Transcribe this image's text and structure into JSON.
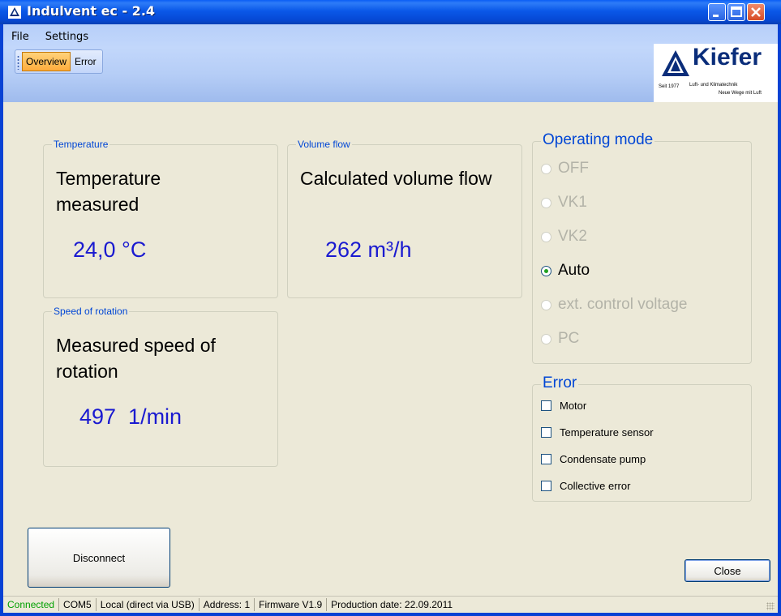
{
  "window": {
    "title": "Indulvent ec - 2.4"
  },
  "menu": {
    "items": [
      "File",
      "Settings"
    ]
  },
  "tabs": [
    {
      "label": "Overview",
      "active": true
    },
    {
      "label": "Error",
      "active": false
    }
  ],
  "logo": {
    "name": "Kiefer",
    "since": "Seit 1977",
    "tagline1": "Luft- und Klimatechnik",
    "tagline2": "Neue Wege mit Luft"
  },
  "temperature": {
    "legend": "Temperature",
    "label": "Temperature measured",
    "value": "24,0 °C"
  },
  "volume_flow": {
    "legend": "Volume flow",
    "label": "Calculated volume flow",
    "value": "262 m³/h"
  },
  "speed": {
    "legend": "Speed of rotation",
    "label": "Measured speed of rotation",
    "value": "497  1/min"
  },
  "operating_mode": {
    "legend": "Operating mode",
    "options": [
      {
        "label": "OFF",
        "enabled": false,
        "selected": false
      },
      {
        "label": "VK1",
        "enabled": false,
        "selected": false
      },
      {
        "label": "VK2",
        "enabled": false,
        "selected": false
      },
      {
        "label": "Auto",
        "enabled": true,
        "selected": true
      },
      {
        "label": "ext. control voltage",
        "enabled": false,
        "selected": false
      },
      {
        "label": "PC",
        "enabled": false,
        "selected": false
      }
    ]
  },
  "error": {
    "legend": "Error",
    "items": [
      {
        "label": "Motor",
        "checked": false
      },
      {
        "label": "Temperature sensor",
        "checked": false
      },
      {
        "label": "Condensate pump",
        "checked": false
      },
      {
        "label": "Collective error",
        "checked": false
      }
    ]
  },
  "buttons": {
    "disconnect": "Disconnect",
    "close": "Close"
  },
  "status": {
    "connection": "Connected",
    "port": "COM5",
    "mode": "Local (direct via USB)",
    "address": "Address: 1",
    "firmware": "Firmware V1.9",
    "production": "Production date: 22.09.2011"
  },
  "colors": {
    "titlebar": "#0a58e8",
    "accent_blue": "#1a1ad0",
    "connected_green": "#00a000",
    "tab_active": "#ffac3c"
  }
}
